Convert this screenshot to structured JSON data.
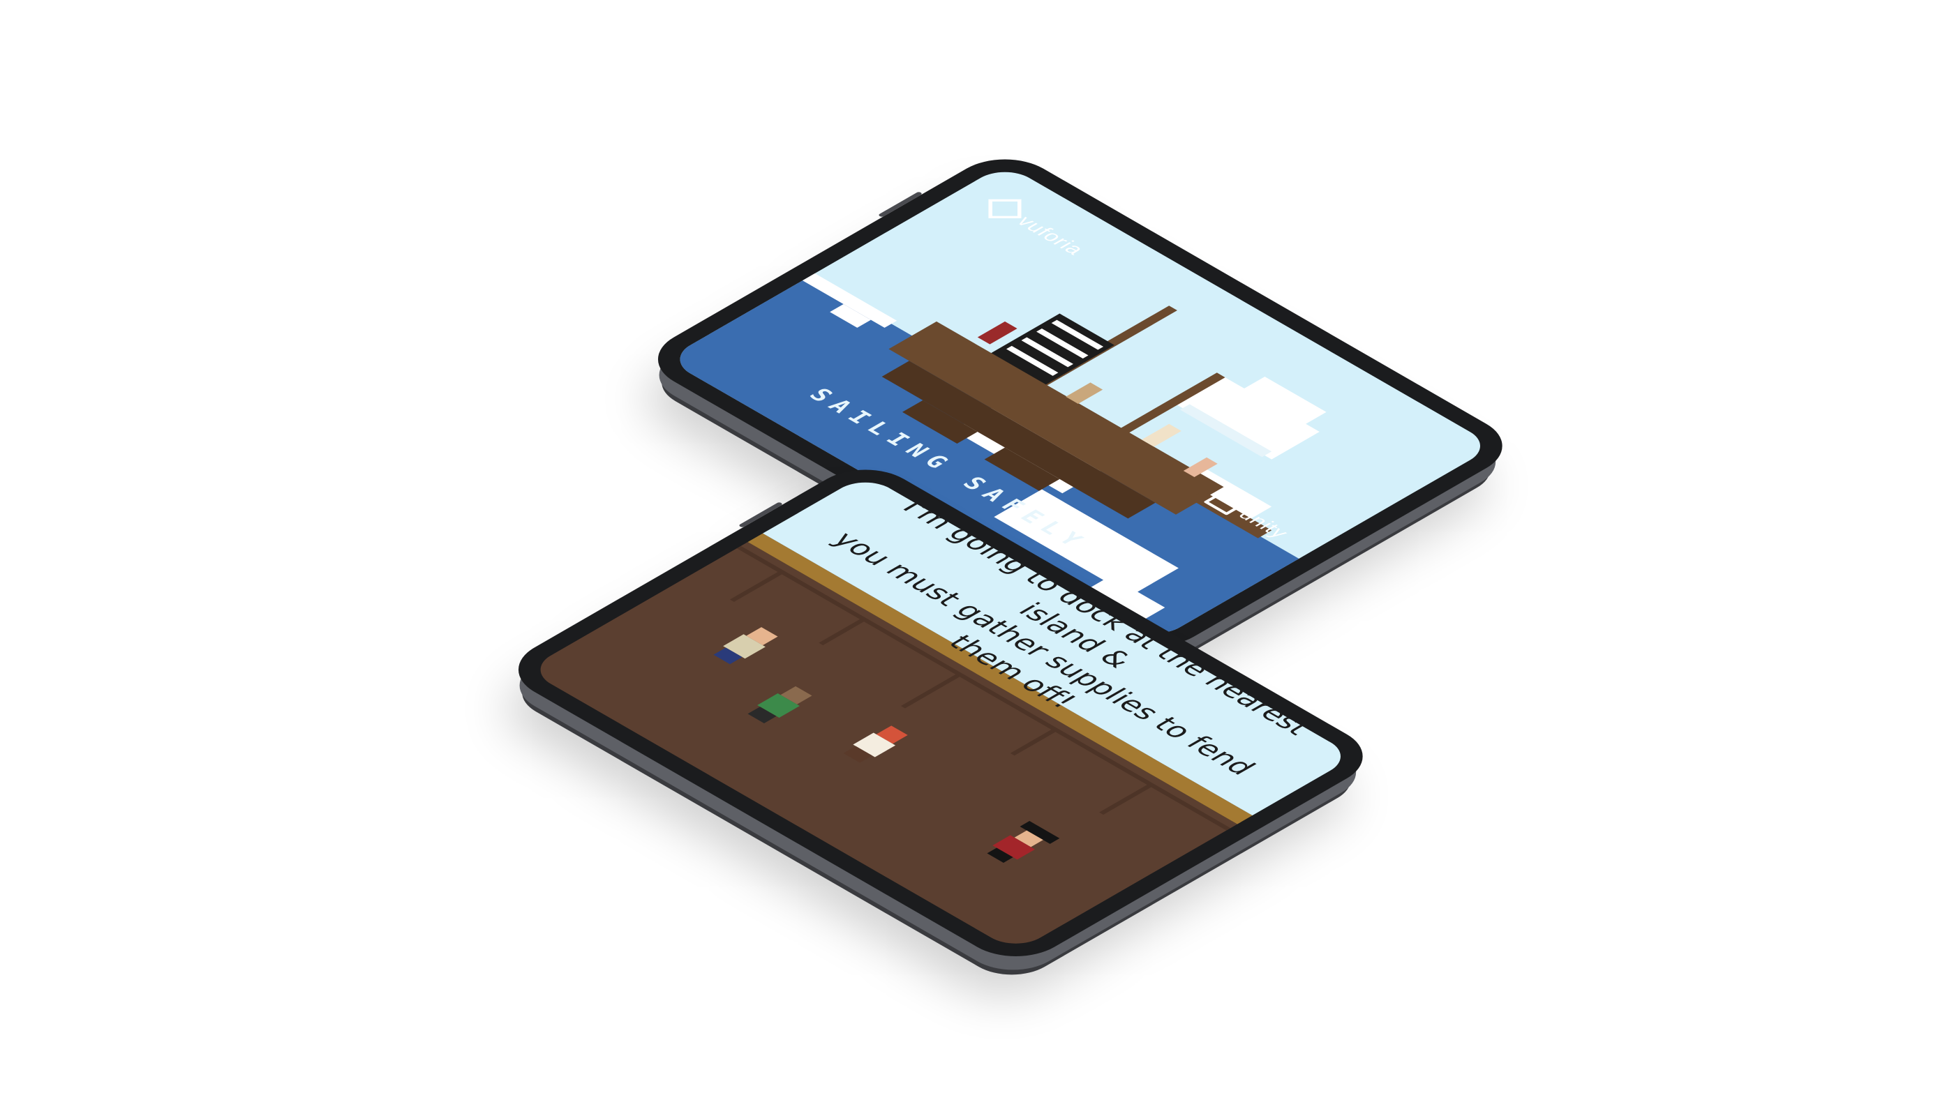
{
  "scene_top": {
    "logo_left": "vuforia",
    "logo_right": "unity",
    "title": "SAILING SAFELY"
  },
  "scene_bottom": {
    "dialog_line1": "I'm going to dock at the nearest island &",
    "dialog_line2": "you must gather supplies to fend them off!"
  },
  "colors": {
    "sky": "#d4f0fa",
    "sea": "#3a6db0",
    "hull": "#6b4a2e",
    "deck": "#5b3f30",
    "rail": "#a47a32",
    "device": "#1b1c1e"
  }
}
